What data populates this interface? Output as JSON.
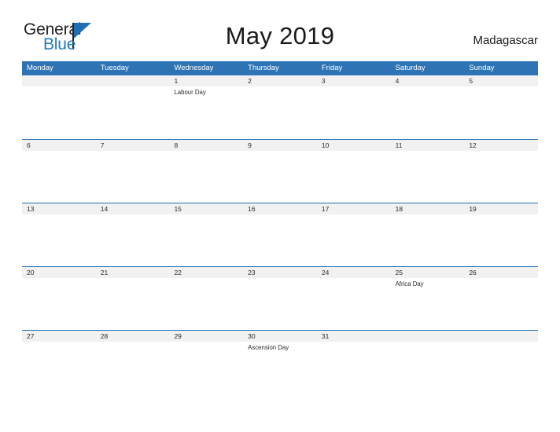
{
  "brand": {
    "logo_text_top": "General",
    "logo_text_bottom": "Blue",
    "accent_color": "#1f6fb4"
  },
  "header": {
    "title": "May 2019",
    "country": "Madagascar"
  },
  "calendar": {
    "header_color": "#2e74b5",
    "band_color": "#f1f1f1",
    "rule_color": "#1f6fb4",
    "weekdays": [
      "Monday",
      "Tuesday",
      "Wednesday",
      "Thursday",
      "Friday",
      "Saturday",
      "Sunday"
    ],
    "weeks": [
      {
        "days": [
          {
            "date": "",
            "event": ""
          },
          {
            "date": "",
            "event": ""
          },
          {
            "date": "1",
            "event": "Labour Day"
          },
          {
            "date": "2",
            "event": ""
          },
          {
            "date": "3",
            "event": ""
          },
          {
            "date": "4",
            "event": ""
          },
          {
            "date": "5",
            "event": ""
          }
        ]
      },
      {
        "days": [
          {
            "date": "6",
            "event": ""
          },
          {
            "date": "7",
            "event": ""
          },
          {
            "date": "8",
            "event": ""
          },
          {
            "date": "9",
            "event": ""
          },
          {
            "date": "10",
            "event": ""
          },
          {
            "date": "11",
            "event": ""
          },
          {
            "date": "12",
            "event": ""
          }
        ]
      },
      {
        "days": [
          {
            "date": "13",
            "event": ""
          },
          {
            "date": "14",
            "event": ""
          },
          {
            "date": "15",
            "event": ""
          },
          {
            "date": "16",
            "event": ""
          },
          {
            "date": "17",
            "event": ""
          },
          {
            "date": "18",
            "event": ""
          },
          {
            "date": "19",
            "event": ""
          }
        ]
      },
      {
        "days": [
          {
            "date": "20",
            "event": ""
          },
          {
            "date": "21",
            "event": ""
          },
          {
            "date": "22",
            "event": ""
          },
          {
            "date": "23",
            "event": ""
          },
          {
            "date": "24",
            "event": ""
          },
          {
            "date": "25",
            "event": "Africa Day"
          },
          {
            "date": "26",
            "event": ""
          }
        ]
      },
      {
        "days": [
          {
            "date": "27",
            "event": ""
          },
          {
            "date": "28",
            "event": ""
          },
          {
            "date": "29",
            "event": ""
          },
          {
            "date": "30",
            "event": "Ascension Day"
          },
          {
            "date": "31",
            "event": ""
          },
          {
            "date": "",
            "event": ""
          },
          {
            "date": "",
            "event": ""
          }
        ]
      }
    ]
  }
}
